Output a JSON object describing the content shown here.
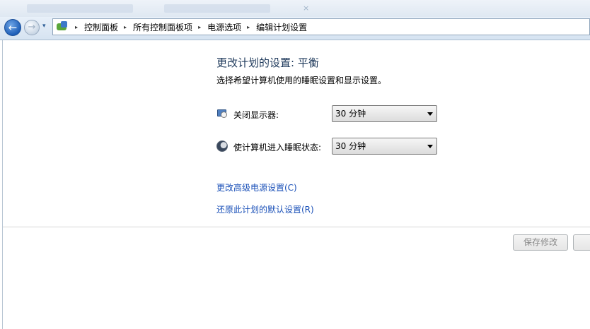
{
  "nav": {
    "back_glyph": "←",
    "forward_glyph": "→",
    "history_glyph": "▾",
    "separator_glyph": "▸",
    "control_panel_icon": "control-panel-icon",
    "breadcrumbs": [
      "控制面板",
      "所有控制面板项",
      "电源选项",
      "编辑计划设置"
    ]
  },
  "page": {
    "title": "更改计划的设置: 平衡",
    "subtitle": "选择希望计算机使用的睡眠设置和显示设置。"
  },
  "settings": [
    {
      "icon": "monitor-clock-icon",
      "label": "关闭显示器:",
      "value": "30 分钟"
    },
    {
      "icon": "moon-icon",
      "label": "使计算机进入睡眠状态:",
      "value": "30 分钟"
    }
  ],
  "links": {
    "advanced": "更改高级电源设置(C)",
    "restore": "还原此计划的默认设置(R)"
  },
  "buttons": {
    "save": "保存修改",
    "cancel": ""
  },
  "colors": {
    "title": "#1e395b",
    "link": "#1a50b8",
    "nav_bar": "#d6e3f1"
  }
}
